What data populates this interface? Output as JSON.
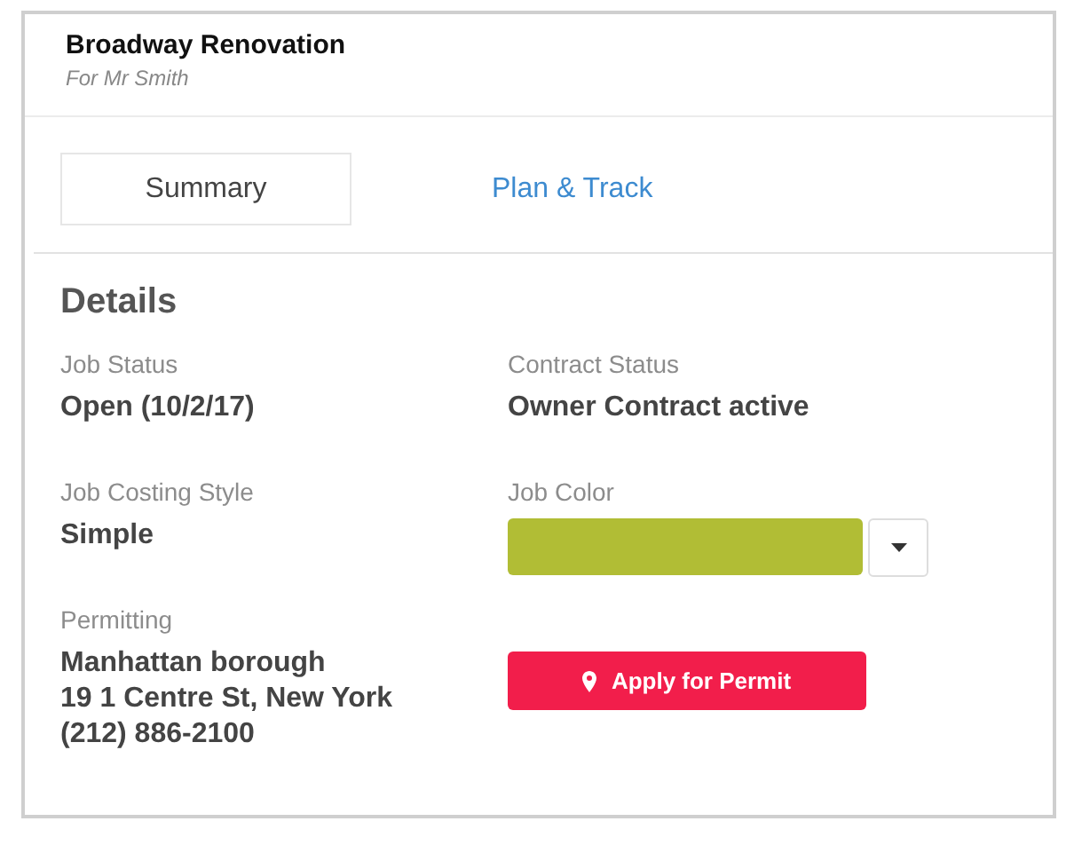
{
  "header": {
    "title": "Broadway Renovation",
    "subtitle": "For Mr Smith"
  },
  "tabs": [
    {
      "label": "Summary",
      "selected": true
    },
    {
      "label": "Plan & Track",
      "selected": false
    }
  ],
  "details": {
    "heading": "Details",
    "fields": [
      {
        "kind": "text",
        "label": "Job Status",
        "value": [
          "Open (10/2/17)"
        ]
      },
      {
        "kind": "text",
        "label": "Contract Status",
        "value": [
          "Owner Contract active"
        ]
      },
      {
        "kind": "text",
        "label": "Job Costing Style",
        "value": [
          "Simple"
        ]
      },
      {
        "kind": "color",
        "label": "Job Color",
        "color": "#b1bd35"
      },
      {
        "kind": "text",
        "label": "Permitting",
        "value": [
          "Manhattan borough",
          "19 1 Centre St, New York",
          "(212) 886-2100"
        ]
      },
      {
        "kind": "button",
        "button": "Apply for Permit"
      }
    ]
  }
}
